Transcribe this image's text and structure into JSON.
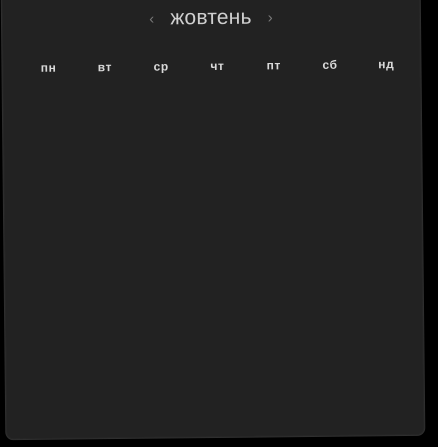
{
  "calendar": {
    "month": "жовтень",
    "prev_arrow": "‹",
    "next_arrow": "›",
    "weekdays": [
      "пн",
      "вт",
      "ср",
      "чт",
      "пт",
      "сб",
      "нд"
    ]
  }
}
